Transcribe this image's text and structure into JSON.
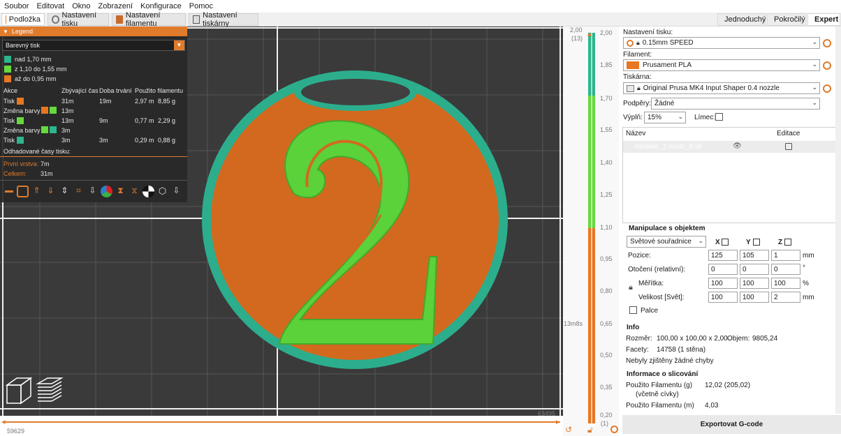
{
  "menu": [
    "Soubor",
    "Editovat",
    "Okno",
    "Zobrazení",
    "Konfigurace",
    "Pomoc"
  ],
  "tabs": [
    {
      "label": "Podložka",
      "icon": "bed-icon",
      "active": true
    },
    {
      "label": "Nastavení tisku",
      "icon": "gear-icon",
      "active": false
    },
    {
      "label": "Nastavení filamentu",
      "icon": "filament-spool-icon",
      "active": false
    },
    {
      "label": "Nastavení tiskárny",
      "icon": "printer-icon",
      "active": false
    }
  ],
  "modes": [
    {
      "label": "Jednoduchý",
      "color": "#3cb043"
    },
    {
      "label": "Pokročilý",
      "color": "#f2c200"
    },
    {
      "label": "Expert",
      "color": "#e02020"
    }
  ],
  "legend": {
    "title": "Legend",
    "view_type": "Barevný tisk",
    "ranges": [
      {
        "label": "nad 1,70 mm",
        "color": "#2db58e"
      },
      {
        "label": "z 1,10 do 1,55 mm",
        "color": "#66d93f"
      },
      {
        "label": "až do 0,95 mm",
        "color": "#e87722"
      }
    ],
    "columns": [
      "Akce",
      "Zbývající čas",
      "Doba trvání",
      "Použito filamentu"
    ],
    "rows": [
      {
        "action": "Tisk",
        "colors": [
          "#e87722"
        ],
        "remaining": "31m",
        "duration": "19m",
        "length": "2,97 m",
        "weight": "8,85 g"
      },
      {
        "action": "Změna barvy",
        "colors": [
          "#e87722",
          "#66d93f"
        ],
        "remaining": "13m",
        "duration": "",
        "length": "",
        "weight": ""
      },
      {
        "action": "Tisk",
        "colors": [
          "#66d93f"
        ],
        "remaining": "13m",
        "duration": "9m",
        "length": "0,77 m",
        "weight": "2,29 g"
      },
      {
        "action": "Změna barvy",
        "colors": [
          "#66d93f",
          "#2db58e"
        ],
        "remaining": "3m",
        "duration": "",
        "length": "",
        "weight": ""
      },
      {
        "action": "Tisk",
        "colors": [
          "#2db58e"
        ],
        "remaining": "3m",
        "duration": "3m",
        "length": "0,29 m",
        "weight": "0,88 g"
      }
    ],
    "estimated_label": "Odhadované časy tisku:",
    "first_layer_label": "První vrstva:",
    "first_layer_value": "7m",
    "total_label": "Celkem:",
    "total_value": "31m"
  },
  "viewport": {
    "h_left_value": "59629",
    "h_right_value": "63495",
    "v_time_label": "13m8s",
    "top_value": "2,00",
    "top_layer": "(13)",
    "bottom_value": "0,20",
    "bottom_layer": "(1)",
    "layer_ticks": [
      "2,00",
      "1,85",
      "1,70",
      "1,55",
      "1,40",
      "1,25",
      "1,10",
      "0,95",
      "0,80",
      "0,65",
      "0,50",
      "0,35",
      "0,20"
    ]
  },
  "sidebar": {
    "print_settings_label": "Nastavení tisku:",
    "print_settings_value": "0.15mm SPEED",
    "filament_label": "Filament:",
    "filament_value": "Prusament PLA",
    "filament_color": "#e87722",
    "printer_label": "Tiskárna:",
    "printer_value": "Original Prusa MK4 Input Shaper 0.4 nozzle",
    "supports_label": "Podpěry:",
    "supports_value": "Žádné",
    "infill_label": "Výplň:",
    "infill_value": "15%",
    "brim_label": "Límec:",
    "list_col_name": "Název",
    "list_col_edit": "Editace",
    "object_name": "medaile_2.misto_b.stl",
    "manip_title": "Manipulace s objektem",
    "coord_system": "Světové souřadnice",
    "axis_x": "X",
    "axis_y": "Y",
    "axis_z": "Z",
    "position_label": "Pozice:",
    "position": [
      "125",
      "105",
      "1"
    ],
    "position_unit": "mm",
    "rotation_label": "Otočení (relativní):",
    "rotation": [
      "0",
      "0",
      "0"
    ],
    "rotation_unit": "°",
    "scale_label": "Měřítka:",
    "scale": [
      "100",
      "100",
      "100"
    ],
    "scale_unit": "%",
    "size_label": "Velikost [Svět]:",
    "size": [
      "100",
      "100",
      "2"
    ],
    "size_unit": "mm",
    "inches_label": "Palce",
    "info_title": "Info",
    "dims_label": "Rozměr:",
    "dims_value": "100,00 x 100,00 x 2,00",
    "volume_label": "Objem:",
    "volume_value": "9805,24",
    "facets_label": "Facety:",
    "facets_value": "14758 (1 stěna)",
    "errors_text": "Nebyly zjištěny žádné chyby",
    "slice_title": "Informace o slicování",
    "used_g_label": "Použito Filamentu (g)",
    "used_g_sub": "(včetně cívky)",
    "used_g_value": "12,02 (205,02)",
    "used_m_label": "Použito Filamentu (m)",
    "used_m_value": "4,03",
    "export_label": "Exportovat G-code"
  }
}
